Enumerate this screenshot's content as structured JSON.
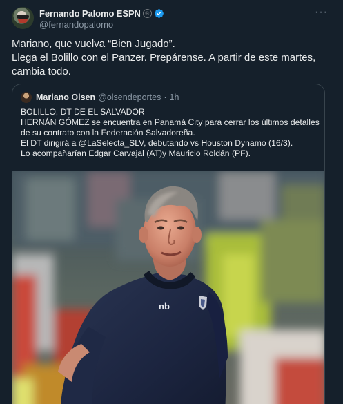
{
  "tweet": {
    "display_name": "Fernando Palomo ESPN",
    "registered_mark": "®",
    "handle": "@fernandopalomo",
    "more_glyph": "···",
    "lines": [
      "Mariano, que vuelva “Bien Jugado”.",
      "Llega el Bolillo con el Panzer. Prepárense. A partir de este martes,",
      "cambia todo."
    ]
  },
  "quote": {
    "name": "Mariano Olsen",
    "handle": "@olsendeportes",
    "separator": "·",
    "time": "1h",
    "lines": [
      "BOLILLO, DT DE EL SALVADOR",
      "HERNÁN GÓMEZ se encuentra en Panamá City para cerrar los últimos detalles",
      "de su contrato con la Federación  Salvadoreña.",
      "El DT dirigirá a @LaSelecta_SLV,  debutando vs Houston Dynamo (16/3).",
      "Lo acompañarían Edgar Carvajal (AT)y Mauricio Roldán (PF)."
    ],
    "photo_logo": "nb"
  },
  "colors": {
    "background": "#15202b",
    "text": "#e7e9ea",
    "secondary": "#8b98a5",
    "verified": "#1d9bf0",
    "border": "#38444d"
  }
}
